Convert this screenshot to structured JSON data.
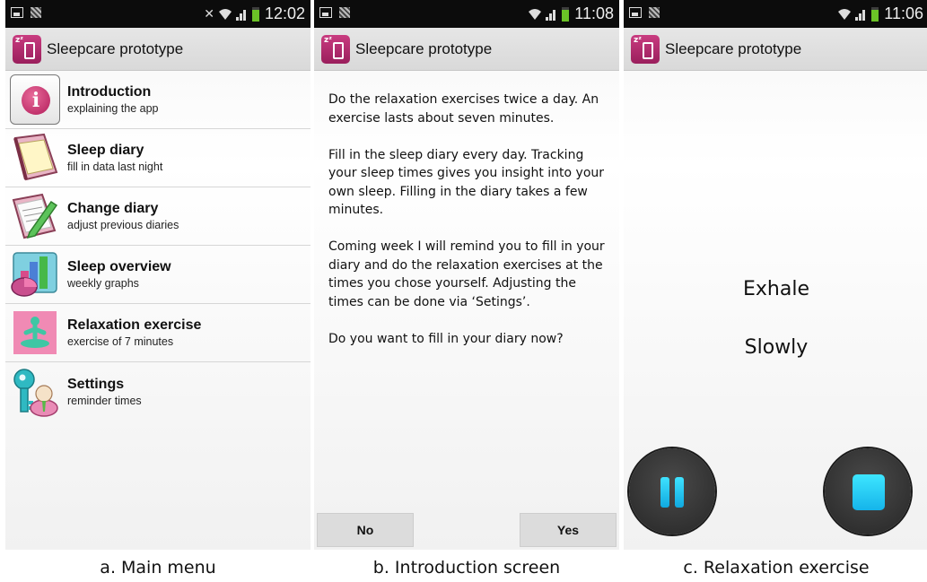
{
  "app": {
    "title": "Sleepcare prototype"
  },
  "status_times": [
    "12:02",
    "11:08",
    "11:06"
  ],
  "menu": {
    "items": [
      {
        "title": "Introduction",
        "subtitle": "explaining the app",
        "icon": "info-icon"
      },
      {
        "title": "Sleep diary",
        "subtitle": "fill in data last night",
        "icon": "notebook-icon"
      },
      {
        "title": "Change diary",
        "subtitle": "adjust previous diaries",
        "icon": "pencil-notebook-icon"
      },
      {
        "title": "Sleep overview",
        "subtitle": "weekly graphs",
        "icon": "graph-icon"
      },
      {
        "title": "Relaxation exercise",
        "subtitle": "exercise of 7 minutes",
        "icon": "meditation-icon"
      },
      {
        "title": "Settings",
        "subtitle": "reminder times",
        "icon": "key-user-icon"
      }
    ]
  },
  "intro": {
    "paragraphs": [
      "Do the relaxation exercises twice a day. An exercise lasts about seven minutes.",
      "Fill in the sleep diary every day. Tracking your sleep times gives you insight into your own sleep. Filling in the diary takes a few minutes.",
      "Coming week I will remind you to fill in your diary and do the relaxation exercises at the times you chose yourself. Adjusting the times can be done via ‘Setings’.",
      "Do you want to fill in your diary now?"
    ],
    "no_label": "No",
    "yes_label": "Yes"
  },
  "relax": {
    "line1": "Exhale",
    "line2": "Slowly"
  },
  "captions": [
    "a. Main menu",
    "b. Introduction screen",
    "c. Relaxation exercise"
  ],
  "colors": {
    "brand": "#b0256a",
    "accent": "#1fc3f0",
    "battery": "#6bc227"
  }
}
